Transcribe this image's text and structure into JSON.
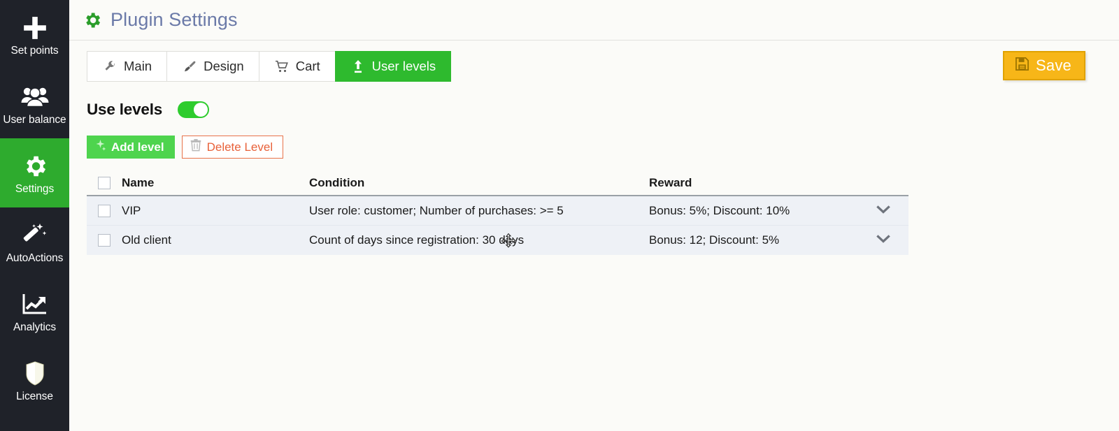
{
  "colors": {
    "sidebar_bg": "#1f2229",
    "sidebar_active": "#2eab2e",
    "tab_active": "#2eba2e",
    "save_bg": "#f7b618",
    "add_level_bg": "#4ed44e",
    "delete_level_text": "#e8613a",
    "toggle_on": "#2ecc2e",
    "title_color": "#6b7aa8",
    "row_bg": "#eef1f6"
  },
  "sidebar": {
    "items": [
      {
        "label": "Set points",
        "icon": "plus-icon",
        "active": false
      },
      {
        "label": "User balance",
        "icon": "users-icon",
        "active": false
      },
      {
        "label": "Settings",
        "icon": "gear-icon",
        "active": true
      },
      {
        "label": "AutoActions",
        "icon": "magic-wand-icon",
        "active": false
      },
      {
        "label": "Analytics",
        "icon": "chart-line-icon",
        "active": false
      },
      {
        "label": "License",
        "icon": "shield-icon",
        "active": false
      }
    ]
  },
  "header": {
    "icon": "gear-icon",
    "title": "Plugin Settings"
  },
  "toolbar": {
    "save_label": "Save",
    "save_icon": "floppy-disk-icon"
  },
  "tabs": [
    {
      "label": "Main",
      "icon": "wrench-icon",
      "active": false
    },
    {
      "label": "Design",
      "icon": "paintbrush-icon",
      "active": false
    },
    {
      "label": "Cart",
      "icon": "shopping-cart-icon",
      "active": false
    },
    {
      "label": "User levels",
      "icon": "upload-arrow-icon",
      "active": true
    }
  ],
  "use_levels": {
    "label": "Use levels",
    "enabled": true
  },
  "actions": {
    "add_level_label": "Add level",
    "add_level_icon": "plus-sparkle-icon",
    "delete_level_label": "Delete Level",
    "delete_level_icon": "trash-icon"
  },
  "table": {
    "columns": [
      "Name",
      "Condition",
      "Reward"
    ],
    "rows": [
      {
        "checked": false,
        "name": "VIP",
        "condition": "User role: customer; Number of purchases: >= 5",
        "reward": "Bonus: 5%; Discount: 10%",
        "expand_icon": "chevron-down-icon"
      },
      {
        "checked": false,
        "name": "Old client",
        "condition": "Count of days since registration: 30 days",
        "reward": "Bonus: 12; Discount: 5%",
        "expand_icon": "chevron-down-icon"
      }
    ]
  },
  "cursor": {
    "type": "move-cursor"
  }
}
